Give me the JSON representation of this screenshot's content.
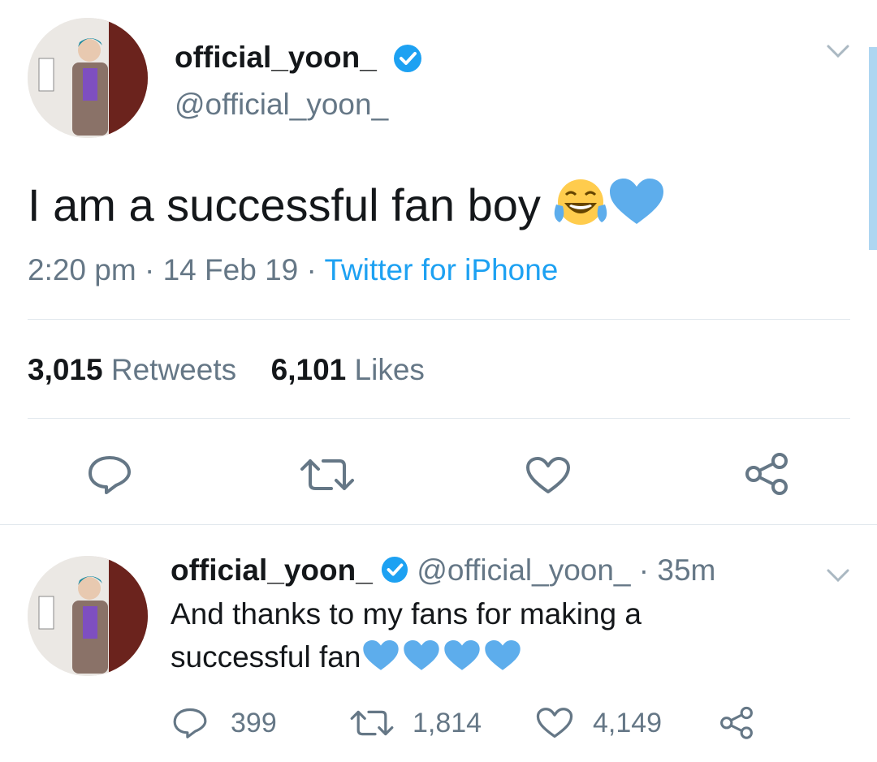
{
  "main_tweet": {
    "display_name": "official_yoon_",
    "handle": "@official_yoon_",
    "text": "I am a successful fan boy",
    "emojis": [
      "face-with-tears-of-joy",
      "blue-heart"
    ],
    "time": "2:20 pm",
    "separator": "·",
    "date": "14 Feb 19",
    "source": "Twitter for iPhone",
    "retweets_count": "3,015",
    "retweets_label": "Retweets",
    "likes_count": "6,101",
    "likes_label": "Likes",
    "actions": [
      "reply-icon",
      "retweet-icon",
      "like-icon",
      "share-icon"
    ]
  },
  "reply_tweet": {
    "display_name": "official_yoon_",
    "handle": "@official_yoon_",
    "separator": "·",
    "age": "35m",
    "text_line1": "And thanks to my fans for making a",
    "text_line2": "successful fan",
    "emojis": [
      "blue-heart",
      "blue-heart",
      "blue-heart",
      "blue-heart"
    ],
    "reply_count": "399",
    "retweet_count": "1,814",
    "like_count": "4,149"
  },
  "colors": {
    "accent": "#1da1f2",
    "muted": "#657786",
    "heart": "#5dadec",
    "verified": "#1da1f2"
  }
}
